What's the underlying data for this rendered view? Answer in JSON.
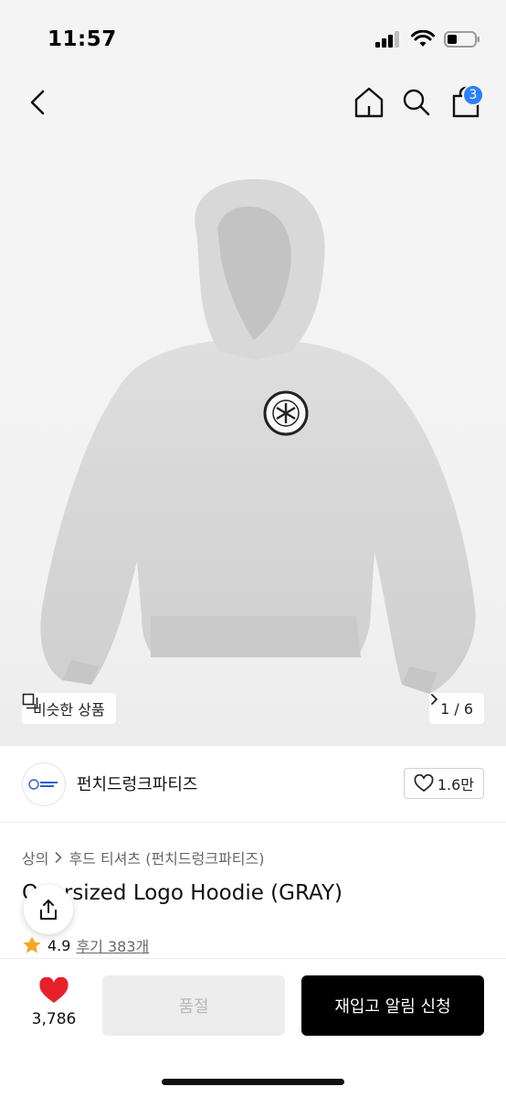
{
  "status_bar": {
    "time": "11:57"
  },
  "nav": {
    "cart_count": "3"
  },
  "hero": {
    "similar_label": "비슷한 상품",
    "pager": "1 / 6"
  },
  "brand": {
    "name": "펀치드렁크파티즈",
    "likes": "1.6만"
  },
  "breadcrumb": {
    "category": "상의",
    "subcategory": "후드 티셔츠 (펀치드렁크파티즈)"
  },
  "product": {
    "title": "Oversized Logo Hoodie (GRAY)",
    "rating": "4.9",
    "reviews": "후기 383개"
  },
  "bottom": {
    "like_count": "3,786",
    "soldout_label": "품절",
    "restock_label": "재입고 알림 신청"
  },
  "colors": {
    "accent_blue": "#2d7ff9",
    "heart_red": "#e8202a",
    "star": "#f5a623"
  }
}
